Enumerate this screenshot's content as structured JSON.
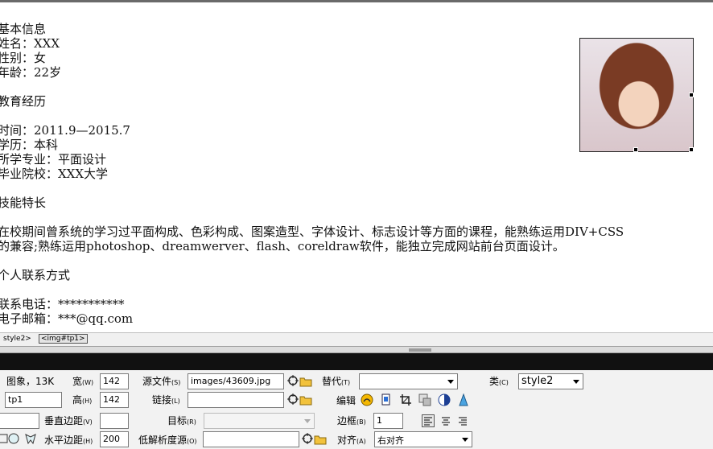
{
  "document": {
    "lines": [
      "基本信息",
      "姓名：XXX",
      "性别：女",
      "年龄：22岁",
      "",
      "教育经历",
      "",
      "时间：2011.9—2015.7",
      "学历：本科",
      "所学专业：平面设计",
      "毕业院校：XXX大学",
      "",
      "技能特长",
      "",
      "在校期间曾系统的学习过平面构成、色彩构成、图案造型、字体设计、标志设计等方面的课程，能熟练运用DIV+CSS",
      "的兼容;熟练运用photoshop、dreamwerver、flash、coreldraw软件，能独立完成网站前台页面设计。",
      "",
      "个人联系方式",
      "",
      "联系电话：***********",
      "电子邮箱：***@qq.com"
    ]
  },
  "tag_selector": {
    "style_tag": "style2>",
    "img_tag": "<img#tp1>"
  },
  "properties": {
    "image_label": "图象，13K",
    "name_value": "tp1",
    "width_label": "宽",
    "width_key": "(W)",
    "width_value": "142",
    "height_label": "高",
    "height_key": "(H)",
    "height_value": "142",
    "src_label": "源文件",
    "src_key": "(S)",
    "src_value": "images/43609.jpg",
    "alt_label": "替代",
    "alt_key": "(T)",
    "alt_value": "",
    "class_label": "类",
    "class_key": "(C)",
    "class_value": "style2",
    "link_label": "链接",
    "link_key": "(L)",
    "link_value": "",
    "edit_label": "编辑",
    "map_value": "",
    "vspace_label": "垂直边距",
    "vspace_key": "(V)",
    "vspace_value": "",
    "target_label": "目标",
    "target_key": "(R)",
    "target_value": "",
    "border_label": "边框",
    "border_key": "(B)",
    "border_value": "1",
    "hspace_label": "水平边距",
    "hspace_key": "(H)",
    "hspace_value": "200",
    "lowsrc_label": "低解析度源",
    "lowsrc_key": "(O)",
    "lowsrc_value": "",
    "align_label": "对齐",
    "align_key": "(A)",
    "align_value": "右对齐"
  },
  "colors": {
    "panel_bg": "#f2f2f2",
    "dark_bar": "#111111",
    "folder_icon": "#f2c23c"
  }
}
